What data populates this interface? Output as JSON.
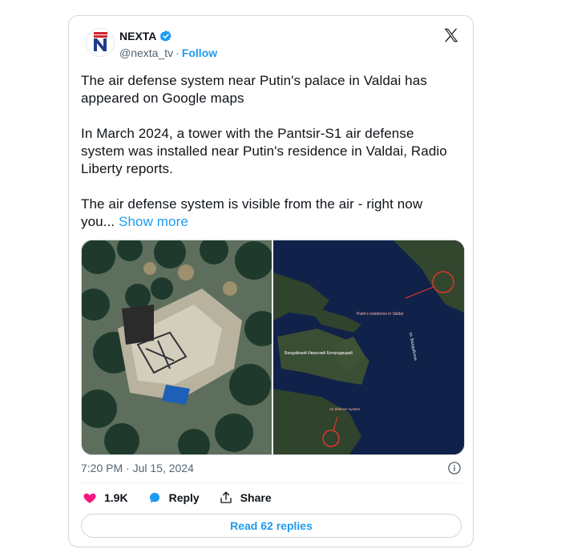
{
  "author": {
    "name": "NEXTA",
    "handle": "@nexta_tv",
    "separator": "·",
    "follow_label": "Follow",
    "avatar_icon": "nexta-logo-icon",
    "verified_color": "#1d9bf0"
  },
  "tweet": {
    "paragraphs": [
      "The air defense system near Putin's palace in Valdai has appeared on Google maps",
      "In March 2024, a tower with the Pantsir-S1 air defense system was installed near Putin's residence in Valdai, Radio Liberty reports.",
      "The air defense system is visible from the air - right now you..."
    ],
    "show_more": "Show more"
  },
  "media": {
    "right_labels": {
      "residence": "Putin's residence in Valdai",
      "monastery": "Валдайский Иверский Богородицкий",
      "lake": "оз. Валдайское",
      "air_defense": "Air defense system"
    },
    "highlight_color": "#e0352b"
  },
  "timestamp": "7:20 PM · Jul 15, 2024",
  "actions": {
    "likes": "1.9K",
    "reply_label": "Reply",
    "share_label": "Share"
  },
  "read_replies": "Read 62 replies",
  "colors": {
    "accent": "#1d9bf0",
    "like": "#f91880",
    "secondary_text": "#536471"
  }
}
